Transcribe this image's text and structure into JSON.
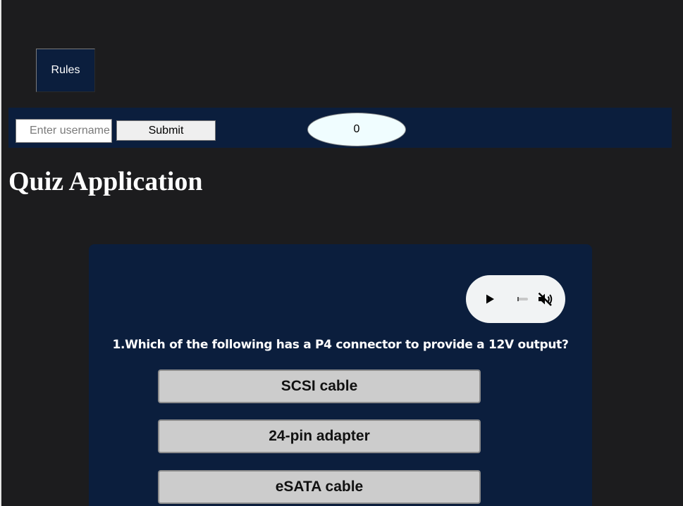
{
  "header": {
    "rules_label": "Rules"
  },
  "topbar": {
    "username_placeholder": "Enter username",
    "submit_label": "Submit",
    "score": "0"
  },
  "title": "Quiz Application",
  "quiz": {
    "question": "1.Which of the following has a P4 connector to provide a 12V output?",
    "options": [
      "SCSI cable",
      "24-pin adapter",
      "eSATA cable"
    ]
  },
  "icons": {
    "play": "play-icon",
    "mute": "volume-muted-icon"
  }
}
